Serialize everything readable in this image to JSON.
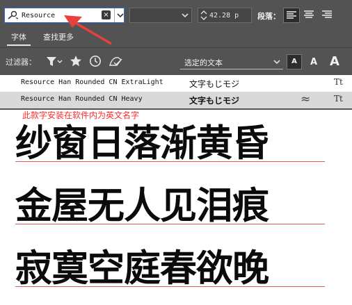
{
  "toolbar": {
    "search_value": "Resource",
    "clear_label": "×",
    "style_value": "",
    "font_size": "42.28 p",
    "paragraph_label": "段落："
  },
  "tabs": [
    {
      "label": "字体"
    },
    {
      "label": "查找更多"
    }
  ],
  "filter": {
    "label": "过滤器：",
    "preview_label": "选定的文本",
    "size_labels": [
      "A",
      "A",
      "A"
    ]
  },
  "fonts": [
    {
      "name": "Resource Han Rounded CN ExtraLight",
      "sample": "文字もじモジ",
      "mark": "",
      "type_icon": "Tt"
    },
    {
      "name": "Resource Han Rounded CN Heavy",
      "sample": "文字もじモジ",
      "mark": "≈",
      "type_icon": "Tt"
    }
  ],
  "content": {
    "note": "此款字安装在软件内为英文名字",
    "lines": [
      "纱窗日落渐黄昏",
      "金屋无人见泪痕",
      "寂寞空庭春欲晚"
    ]
  },
  "colors": {
    "panel": "#535353",
    "accent_border": "#2f6ccd",
    "note_red": "#ff2b2b",
    "selected_row": "#d9d9d9",
    "arrow_red": "#e8413c"
  }
}
